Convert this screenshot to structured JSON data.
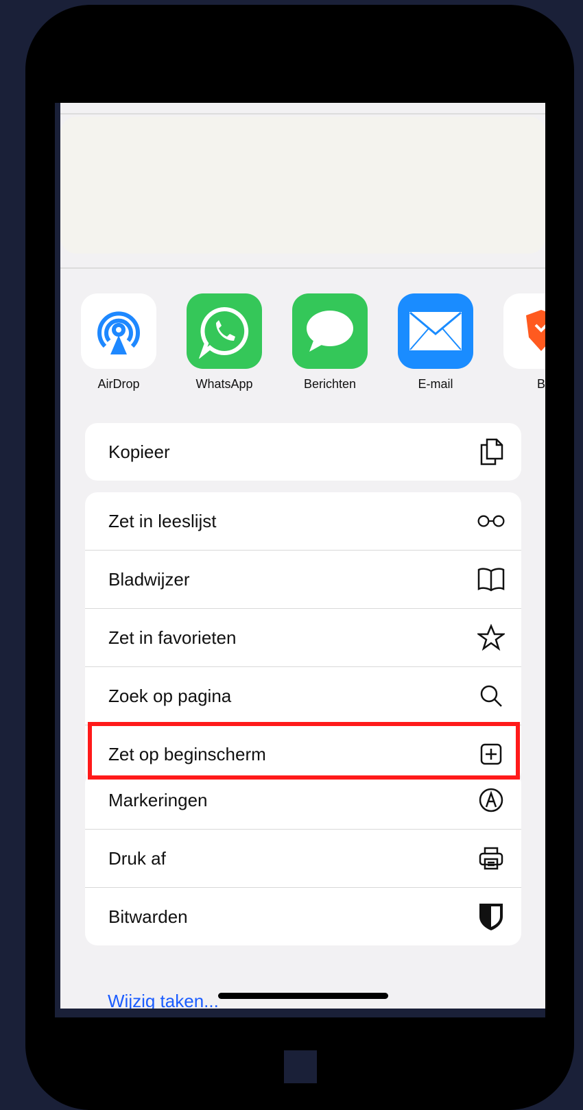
{
  "share_targets": [
    {
      "label": "AirDrop",
      "icon": "airdrop-icon",
      "color": "#1e88ff"
    },
    {
      "label": "WhatsApp",
      "icon": "whatsapp-icon",
      "color": "#35c759"
    },
    {
      "label": "Berichten",
      "icon": "messages-icon",
      "color": "#34c759"
    },
    {
      "label": "E-mail",
      "icon": "mail-icon",
      "color": "#1a8cff"
    },
    {
      "label": "B",
      "icon": "brave-icon",
      "color": "#ff5a1f"
    }
  ],
  "actions": {
    "copy": {
      "label": "Kopieer",
      "icon": "copy-icon"
    },
    "reading_list": {
      "label": "Zet in leeslijst",
      "icon": "glasses-icon"
    },
    "bookmark": {
      "label": "Bladwijzer",
      "icon": "book-icon"
    },
    "favorites": {
      "label": "Zet in favorieten",
      "icon": "star-icon"
    },
    "find": {
      "label": "Zoek op pagina",
      "icon": "search-icon"
    },
    "home_screen": {
      "label": "Zet op beginscherm",
      "icon": "add-square-icon"
    },
    "markup": {
      "label": "Markeringen",
      "icon": "markup-icon"
    },
    "print": {
      "label": "Druk af",
      "icon": "printer-icon"
    },
    "bitwarden": {
      "label": "Bitwarden",
      "icon": "bitwarden-shield-icon"
    }
  },
  "edit_actions_label": "Wijzig taken...",
  "highlight_color": "#ff1a1a"
}
